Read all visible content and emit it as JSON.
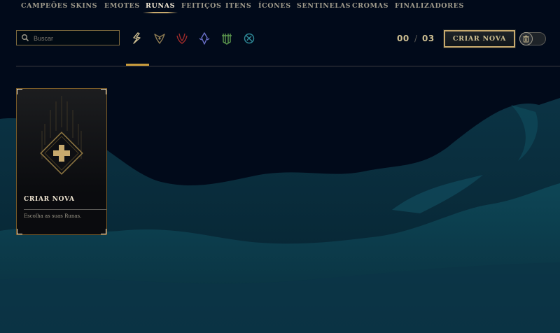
{
  "nav": {
    "tabs": [
      {
        "label": "CAMPEÕES"
      },
      {
        "label": "SKINS"
      },
      {
        "label": "EMOTES"
      },
      {
        "label": "RUNAS",
        "active": true
      },
      {
        "label": "FEITIÇOS"
      },
      {
        "label": "ITENS"
      },
      {
        "label": "ÍCONES"
      },
      {
        "label": "SENTINELAS"
      },
      {
        "label": "CROMAS"
      },
      {
        "label": "FINALIZADORES"
      }
    ]
  },
  "search": {
    "placeholder": "Buscar",
    "value": ""
  },
  "filters": {
    "items": [
      {
        "icon": "all-runes-icon",
        "color": "#cdbe91",
        "selected": true
      },
      {
        "icon": "precision-icon",
        "color": "#c8aa6e"
      },
      {
        "icon": "domination-icon",
        "color": "#d44242"
      },
      {
        "icon": "sorcery-icon",
        "color": "#9faafc"
      },
      {
        "icon": "resolve-icon",
        "color": "#a1d586"
      },
      {
        "icon": "inspiration-icon",
        "color": "#49aab9"
      }
    ]
  },
  "counter": {
    "current": "00",
    "max": "03",
    "separator": "/"
  },
  "toolbar": {
    "create_label": "CRIAR NOVA",
    "delete_toggle_icon": "trash-icon"
  },
  "card": {
    "title": "CRIAR NOVA",
    "subtitle": "Escolha as suas Runas.",
    "icon": "plus-icon"
  },
  "colors": {
    "background": "#010a1a",
    "gold": "#c8aa6e",
    "gold_text": "#cdbe91",
    "accent_underline": "#c89b3c",
    "teal": "#0e4a5a"
  }
}
